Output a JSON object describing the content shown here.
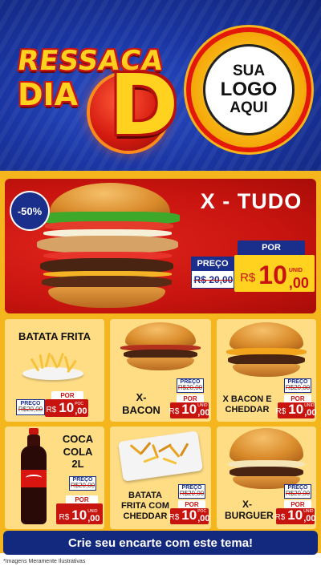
{
  "header": {
    "title_line1": "RESSACA",
    "title_line2": "DIA",
    "title_letter": "D",
    "logo_line1": "SUA",
    "logo_line2": "LOGO",
    "logo_line3": "AQUI"
  },
  "featured": {
    "discount_badge": "-50%",
    "name": "X - TUDO",
    "was_label": "PREÇO",
    "was_price": "R$ 20,00",
    "now_label": "POR",
    "currency": "R$",
    "price_int": "10",
    "price_cents": ",00",
    "unit": "UNID"
  },
  "products": [
    {
      "name": "BATATA FRITA",
      "was_label": "PREÇO",
      "was_price": "R$20,00",
      "now_label": "POR",
      "currency": "R$",
      "price_int": "10",
      "price_cents": ",00",
      "unit": "POC"
    },
    {
      "name": "X-BACON",
      "was_label": "PREÇO",
      "was_price": "R$20,00",
      "now_label": "POR",
      "currency": "R$",
      "price_int": "10",
      "price_cents": ",00",
      "unit": "UNID"
    },
    {
      "name": "X BACON E CHEDDAR",
      "was_label": "PREÇO",
      "was_price": "R$20,00",
      "now_label": "POR",
      "currency": "R$",
      "price_int": "10",
      "price_cents": ",00",
      "unit": "UNID"
    },
    {
      "name": "COCA COLA 2L",
      "was_label": "PREÇO",
      "was_price": "R$20,00",
      "now_label": "POR",
      "currency": "R$",
      "price_int": "10",
      "price_cents": ",00",
      "unit": "UNID"
    },
    {
      "name": "BATATA FRITA COM CHEDDAR",
      "was_label": "PREÇO",
      "was_price": "R$20,00",
      "now_label": "POR",
      "currency": "R$",
      "price_int": "10",
      "price_cents": ",00",
      "unit": "POC"
    },
    {
      "name": "X-BURGUER",
      "was_label": "PREÇO",
      "was_price": "R$20,00",
      "now_label": "POR",
      "currency": "R$",
      "price_int": "10",
      "price_cents": ",00",
      "unit": "UNID"
    }
  ],
  "footer": {
    "cta": "Crie seu encarte com este tema!",
    "disclaimer": "*Imagens Meramente Ilustrativas"
  },
  "colors": {
    "header_blue": "#1a36a3",
    "body_yellow": "#f5b51d",
    "hero_red": "#c8140f",
    "price_red": "#c8140f",
    "navy": "#13297e",
    "accent_yellow": "#ffd21f"
  },
  "icons": [
    "discount-badge",
    "burger-image",
    "fries-image",
    "soda-bottle-image"
  ]
}
